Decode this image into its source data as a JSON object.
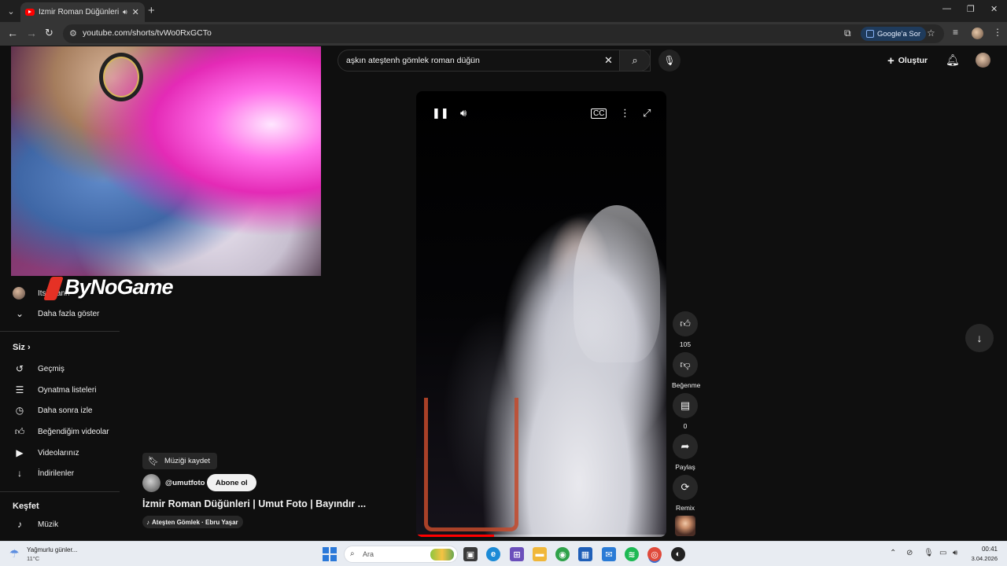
{
  "browser": {
    "tab_title": "İzmir Roman Düğünleri | Um",
    "url": "youtube.com/shorts/tvWo0RxGCTo",
    "google_ask": "Google'a Sor"
  },
  "youtube": {
    "search_query": "aşkın ateştenh gömlek roman düğün",
    "create_label": "Oluştur",
    "sidebar": {
      "partial_channel": "Itsk...ann",
      "show_more": "Daha fazla göster",
      "you_heading": "Siz",
      "you_items": [
        {
          "label": "Geçmiş",
          "icon": "history-icon"
        },
        {
          "label": "Oynatma listeleri",
          "icon": "playlists-icon"
        },
        {
          "label": "Daha sonra izle",
          "icon": "watch-later-icon"
        },
        {
          "label": "Beğendiğim videolar",
          "icon": "liked-videos-icon"
        },
        {
          "label": "Videolarınız",
          "icon": "your-videos-icon"
        },
        {
          "label": "İndirilenler",
          "icon": "downloads-icon"
        }
      ],
      "explore_heading": "Keşfet",
      "explore_items": [
        {
          "label": "Müzik",
          "icon": "music-icon"
        }
      ]
    },
    "short": {
      "save_music": "Müziği kaydet",
      "channel": "@umutfoto",
      "subscribe": "Abone ol",
      "title": "İzmir Roman Düğünleri | Umut Foto | Bayındır ...",
      "song": "Ateşten Gömlek · Ebru Yaşar",
      "progress": 0.31
    },
    "actions": {
      "likes": "105",
      "dislike_label": "Beğenme",
      "comments": "0",
      "share_label": "Paylaş",
      "remix_label": "Remix"
    }
  },
  "overlay": {
    "logo_text": "ByNoGame"
  },
  "taskbar": {
    "weather_text": "Yağmurlu günler...",
    "temperature": "11°C",
    "search_placeholder": "Ara",
    "time": "00:41",
    "date": "3.04.2026"
  }
}
